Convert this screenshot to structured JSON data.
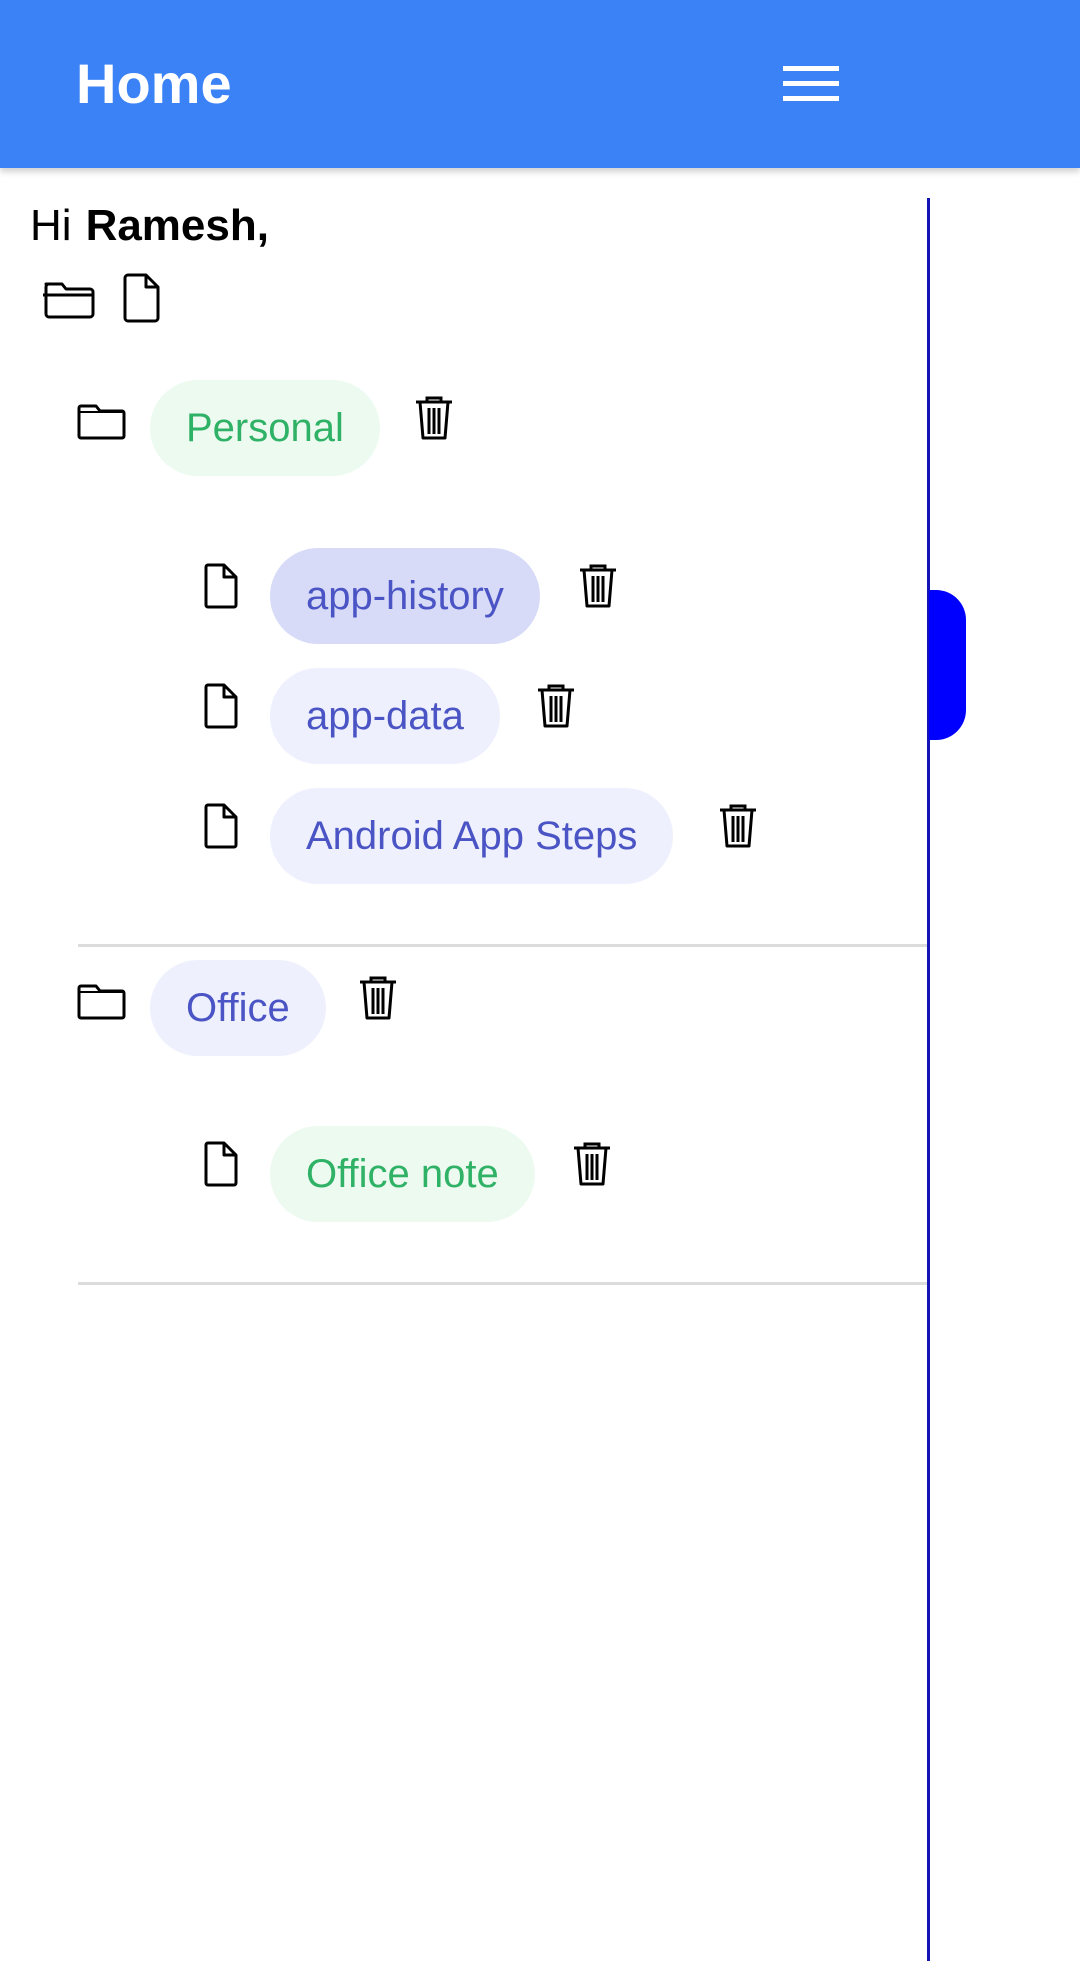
{
  "appbar": {
    "title": "Home",
    "menu_icon": "hamburger-menu-icon"
  },
  "greeting": {
    "prefix": "Hi",
    "name": "Ramesh,"
  },
  "toolbar": {
    "new_folder_icon": "folder-open-icon",
    "new_file_icon": "file-icon"
  },
  "folders": [
    {
      "label": "Personal",
      "notes": [
        {
          "label": "app-history"
        },
        {
          "label": "app-data"
        },
        {
          "label": "Android App Steps"
        }
      ]
    },
    {
      "label": "Office",
      "notes": [
        {
          "label": "Office note"
        }
      ]
    }
  ],
  "colors": {
    "appbar": "#3b82f6",
    "chip_green_bg": "#ecfaf0",
    "chip_green_text": "#2fb266",
    "chip_blue_bg": "#eef1fd",
    "chip_blue_text": "#4b54c4",
    "drawer_handle": "#0000ff"
  }
}
